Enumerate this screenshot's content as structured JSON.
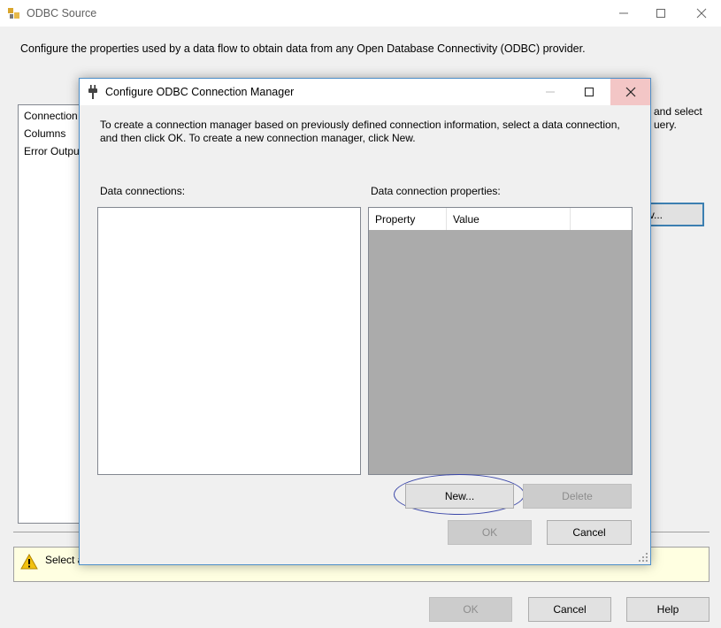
{
  "main_window": {
    "title": "ODBC Source",
    "description": "Configure the properties used by a data flow to obtain data from any Open Database Connectivity (ODBC) provider.",
    "nav_items": [
      "Connection",
      "Columns",
      "Error Outpu"
    ],
    "partial_text_line1": "and select",
    "partial_text_line2": "uery.",
    "partial_button_label": "v...",
    "warning_text": "Select a",
    "buttons": {
      "ok": "OK",
      "cancel": "Cancel",
      "help": "Help"
    }
  },
  "dialog": {
    "title": "Configure ODBC Connection Manager",
    "instructions": "To create a connection manager based on previously defined connection information, select a data connection, and then click OK. To create a new connection manager, click New.",
    "data_connections_label": "Data connections:",
    "properties_label": "Data connection properties:",
    "columns": [
      "Property",
      "Value"
    ],
    "buttons": {
      "new": "New...",
      "delete": "Delete",
      "ok": "OK",
      "cancel": "Cancel"
    }
  },
  "colors": {
    "highlight_ellipse": "#3a46a8",
    "close_hover": "#f3c6c6",
    "warning_bg": "#ffffe1"
  }
}
